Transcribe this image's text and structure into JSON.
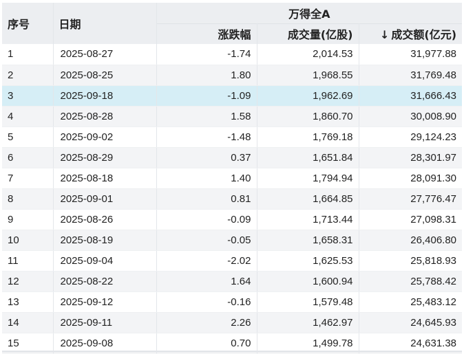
{
  "table": {
    "headers": {
      "index": "序号",
      "date": "日期",
      "group": "万得全A",
      "change": "涨跌幅",
      "volume": "成交量(亿股)",
      "sort_arrow": "↓",
      "amount": "成交额(亿元)"
    },
    "selected_row": 3,
    "rows": [
      {
        "index": "1",
        "date": "2025-08-27",
        "change": "-1.74",
        "volume": "2,014.53",
        "amount": "31,977.88"
      },
      {
        "index": "2",
        "date": "2025-08-25",
        "change": "1.80",
        "volume": "1,968.55",
        "amount": "31,769.48"
      },
      {
        "index": "3",
        "date": "2025-09-18",
        "change": "-1.09",
        "volume": "1,962.69",
        "amount": "31,666.43"
      },
      {
        "index": "4",
        "date": "2025-08-28",
        "change": "1.58",
        "volume": "1,860.70",
        "amount": "30,008.90"
      },
      {
        "index": "5",
        "date": "2025-09-02",
        "change": "-1.48",
        "volume": "1,769.18",
        "amount": "29,124.23"
      },
      {
        "index": "6",
        "date": "2025-08-29",
        "change": "0.37",
        "volume": "1,651.84",
        "amount": "28,301.97"
      },
      {
        "index": "7",
        "date": "2025-08-18",
        "change": "1.40",
        "volume": "1,794.94",
        "amount": "28,091.30"
      },
      {
        "index": "8",
        "date": "2025-09-01",
        "change": "0.81",
        "volume": "1,664.85",
        "amount": "27,776.47"
      },
      {
        "index": "9",
        "date": "2025-08-26",
        "change": "-0.09",
        "volume": "1,713.44",
        "amount": "27,098.31"
      },
      {
        "index": "10",
        "date": "2025-08-19",
        "change": "-0.05",
        "volume": "1,658.31",
        "amount": "26,406.80"
      },
      {
        "index": "11",
        "date": "2025-09-04",
        "change": "-2.02",
        "volume": "1,625.53",
        "amount": "25,818.93"
      },
      {
        "index": "12",
        "date": "2025-08-22",
        "change": "1.64",
        "volume": "1,600.94",
        "amount": "25,788.42"
      },
      {
        "index": "13",
        "date": "2025-09-12",
        "change": "-0.16",
        "volume": "1,579.48",
        "amount": "25,483.12"
      },
      {
        "index": "14",
        "date": "2025-09-11",
        "change": "2.26",
        "volume": "1,462.97",
        "amount": "24,645.93"
      },
      {
        "index": "15",
        "date": "2025-09-08",
        "change": "0.70",
        "volume": "1,499.78",
        "amount": "24,631.38"
      }
    ]
  }
}
